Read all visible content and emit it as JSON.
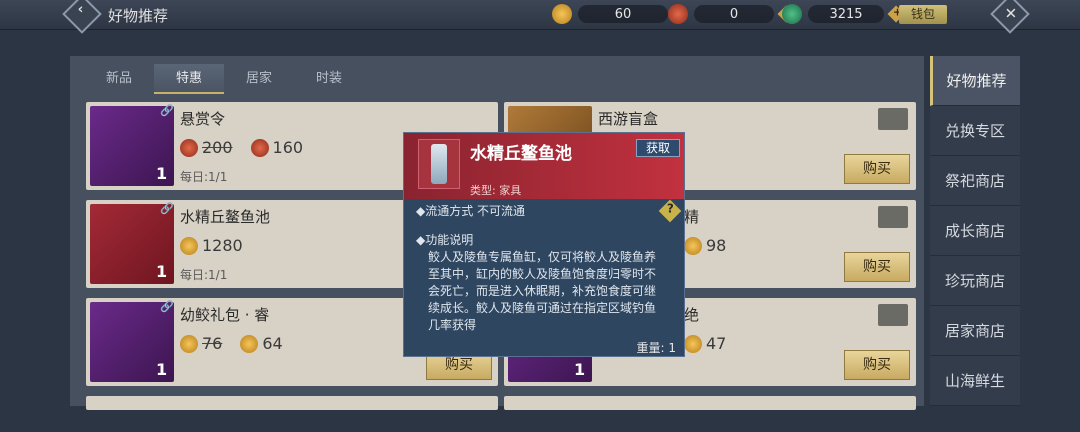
{
  "header": {
    "title": "好物推荐",
    "wallet_label": "钱包"
  },
  "currency": [
    {
      "name": "gold-coin",
      "value": "60"
    },
    {
      "name": "red-coin",
      "value": "0"
    },
    {
      "name": "green-jade",
      "value": "3215"
    }
  ],
  "tabs": [
    "新品",
    "特惠",
    "居家",
    "时装"
  ],
  "active_tab": "特惠",
  "sidebar": [
    "好物推荐",
    "兑换专区",
    "祭祀商店",
    "成长商店",
    "珍玩商店",
    "居家商店",
    "山海鲜生"
  ],
  "cards": [
    {
      "name": "悬赏令",
      "qty": "1",
      "old_price": "200",
      "price": "160",
      "limit": "每日:1/1"
    },
    {
      "name": "西游盲盒",
      "buy": "购买"
    },
    {
      "name": "水精丘鳌鱼池",
      "qty": "1",
      "price": "1280",
      "limit": "每日:1/1"
    },
    {
      "name_tail": "精",
      "price": "98",
      "buy": "购买"
    },
    {
      "name": "幼鲛礼包 · 睿",
      "qty": "1",
      "old_price": "76",
      "price": "64",
      "buy": "购买"
    },
    {
      "name_tail": "绝",
      "qty": "1",
      "price": "47",
      "buy": "购买"
    }
  ],
  "popup": {
    "title": "水精丘鳌鱼池",
    "get_label": "获取",
    "type": "类型: 家具",
    "circulation": "◆流通方式   不可流通",
    "func_title": "◆功能说明",
    "desc": "鲛人及陵鱼专属鱼缸，仅可将鲛人及陵鱼养至其中，缸内的鲛人及陵鱼饱食度归零时不会死亡，而是进入休眠期，补充饱食度可继续成长。鲛人及陵鱼可通过在指定区域钓鱼几率获得",
    "weight": "重量: 1"
  }
}
